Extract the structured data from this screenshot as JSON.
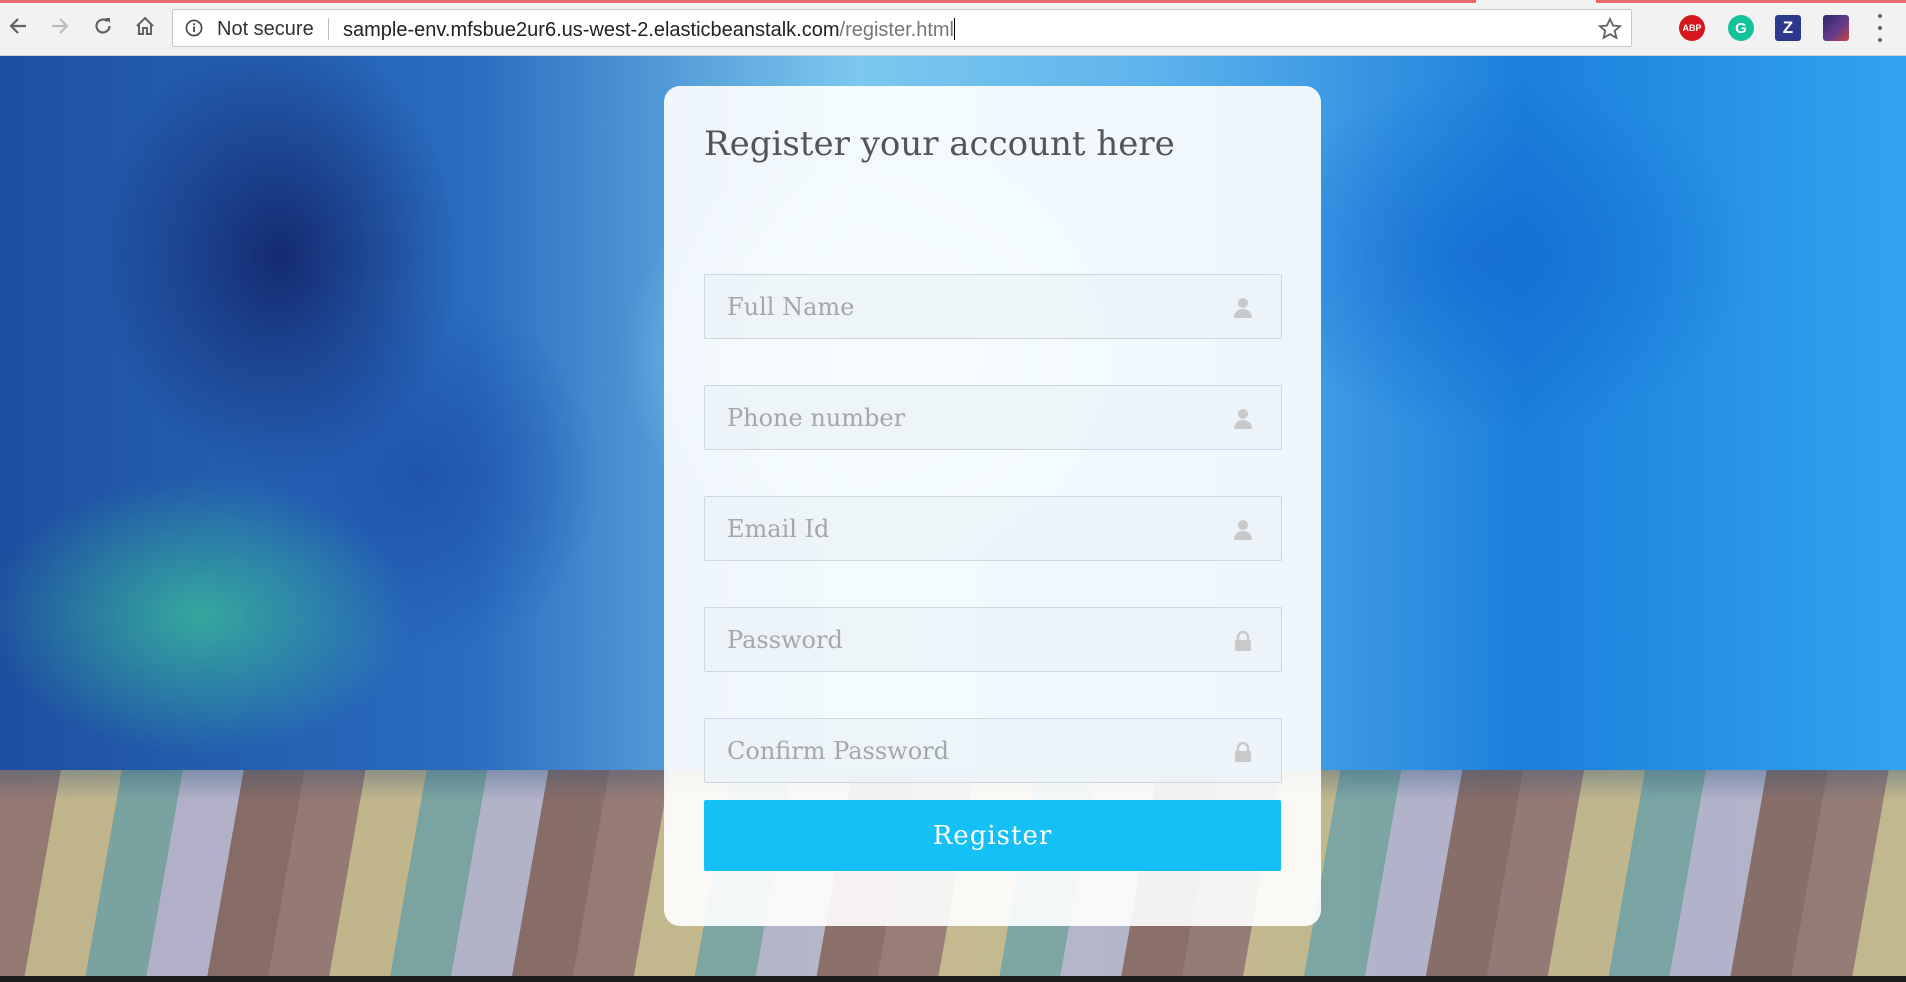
{
  "browser": {
    "security_label": "Not secure",
    "url_host": "sample-env.mfsbue2ur6.us-west-2.elasticbeanstalk.com",
    "url_path": "/register.html",
    "nav_icons": [
      "back-arrow-icon",
      "forward-arrow-icon",
      "reload-icon",
      "home-icon"
    ],
    "extensions": [
      {
        "name": "adblock-plus-icon",
        "label": "ABP",
        "color": "#d5161c"
      },
      {
        "name": "grammarly-icon",
        "label": "G",
        "color": "#15c39a"
      },
      {
        "name": "zotero-icon",
        "label": "Z",
        "color": "#2b3a8c"
      },
      {
        "name": "extension-photo-icon",
        "label": "",
        "color": "#4a3a8a"
      }
    ]
  },
  "form": {
    "title": "Register your account here",
    "fields": [
      {
        "placeholder": "Full Name",
        "value": "",
        "icon": "user-icon"
      },
      {
        "placeholder": "Phone number",
        "value": "",
        "icon": "user-icon"
      },
      {
        "placeholder": "Email Id",
        "value": "",
        "icon": "user-icon"
      },
      {
        "placeholder": "Password",
        "value": "",
        "icon": "lock-icon"
      },
      {
        "placeholder": "Confirm Password",
        "value": "",
        "icon": "lock-icon"
      }
    ],
    "submit_label": "Register"
  },
  "colors": {
    "accent": "#14c0f5",
    "field_icon": "#c9c9c9",
    "title_text": "#555555"
  }
}
